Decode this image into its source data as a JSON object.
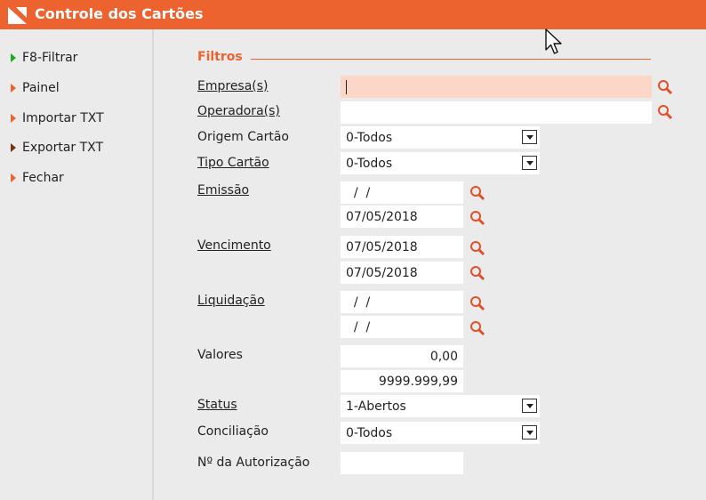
{
  "window": {
    "title": "Controle dos Cartões",
    "accent_color": "#ec6330"
  },
  "sidebar": {
    "items": [
      {
        "label": "F8-Filtrar",
        "icon": "green-arrow-icon"
      },
      {
        "label": "Painel",
        "icon": "orange-arrow-icon"
      },
      {
        "label": "Importar TXT",
        "icon": "orange-arrow-icon"
      },
      {
        "label": "Exportar TXT",
        "icon": "brown-arrow-icon"
      },
      {
        "label": "Fechar",
        "icon": "orange-arrow-icon"
      }
    ]
  },
  "filters": {
    "legend": "Filtros",
    "empresa": {
      "label": "Empresa(s)",
      "value": ""
    },
    "operadora": {
      "label": "Operadora(s)",
      "value": ""
    },
    "origem": {
      "label": "Origem Cartão",
      "value": "0-Todos"
    },
    "tipo": {
      "label": "Tipo Cartão",
      "value": "0-Todos"
    },
    "emissao": {
      "label": "Emissão",
      "from": "  /  /",
      "to": "07/05/2018"
    },
    "vencimento": {
      "label": "Vencimento",
      "from": "07/05/2018",
      "to": "07/05/2018"
    },
    "liquidacao": {
      "label": "Liquidação",
      "from": "  /  /",
      "to": "  /  /"
    },
    "valores": {
      "label": "Valores",
      "from": "0,00",
      "to": "9999.999,99"
    },
    "status": {
      "label": "Status",
      "value": "1-Abertos"
    },
    "conciliacao": {
      "label": "Conciliação",
      "value": "0-Todos"
    },
    "autorizacao": {
      "label": "Nº da Autorização",
      "value": ""
    }
  }
}
